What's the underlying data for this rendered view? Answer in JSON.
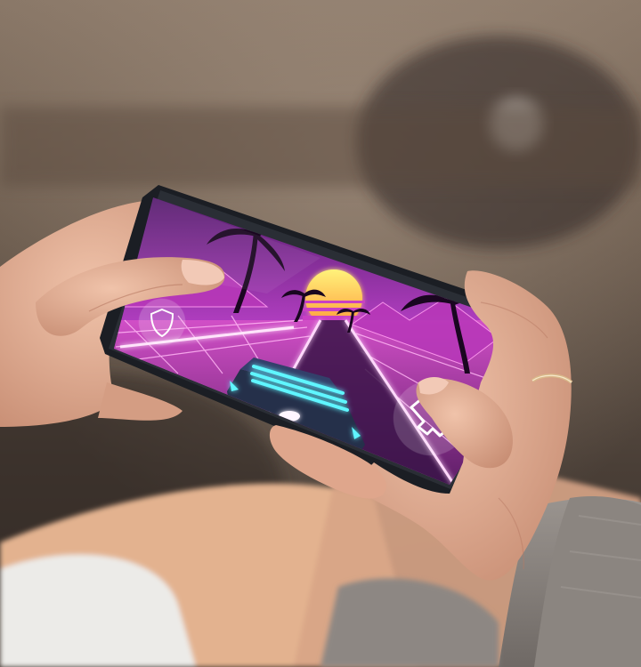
{
  "scene": {
    "description_free": true,
    "colors": {
      "background_warm": "#7a6656",
      "background_dark": "#3d322a",
      "sky_magenta": "#c93fc4",
      "sky_pink": "#f07fd8",
      "sun_yellow": "#ffe34d",
      "sun_orange": "#ff9a3a",
      "neon_cyan": "#5ff6ff",
      "phone_frame": "#1d2026",
      "skin": "#e6b29a",
      "skin_shadow": "#b87a63",
      "ring_gold": "#d9b98a",
      "sweater_gray": "#8e8884",
      "shorts_white": "#e9e7e4"
    },
    "game_controls": [
      {
        "name": "shield-button",
        "icon": "shield-icon"
      },
      {
        "name": "puzzle-button",
        "icon": "puzzle-piece-icon"
      }
    ]
  }
}
